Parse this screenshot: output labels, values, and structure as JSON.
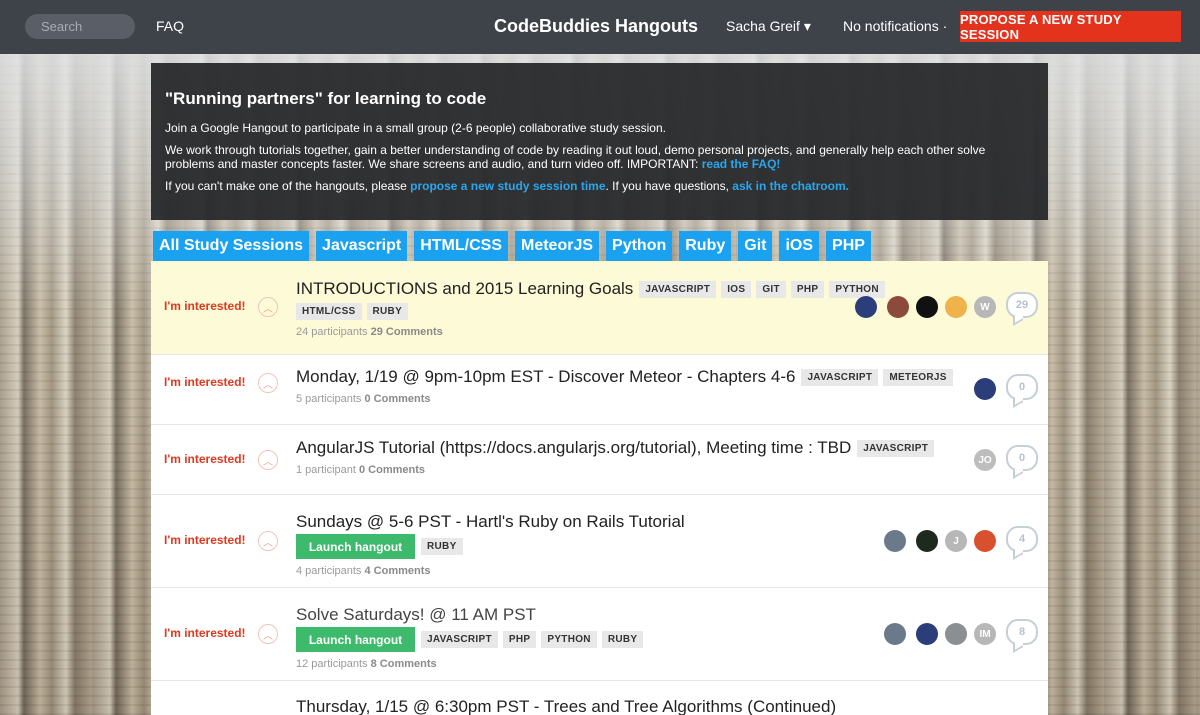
{
  "topbar": {
    "search_placeholder": "Search",
    "faq": "FAQ",
    "brand": "CodeBuddies Hangouts",
    "user": "Sacha Greif ▾",
    "notifications": "No notifications ·",
    "propose_button": "PROPOSE A NEW STUDY SESSION"
  },
  "intro": {
    "heading": "\"Running partners\" for learning to code",
    "p1": "Join a Google Hangout to participate in a small group (2-6 people) collaborative study session.",
    "p2_text": "We work through tutorials together, gain a better understanding of code by reading it out loud, demo personal projects, and generally help each other solve problems and master concepts faster. We share screens and audio, and turn video off. IMPORTANT: ",
    "p2_link": "read the FAQ!",
    "p3_a": "If you can't make one of the hangouts, please ",
    "p3_link1": "propose a new study session time",
    "p3_b": ". If you have questions, ",
    "p3_link2": "ask in the chatroom."
  },
  "tabs": [
    "All Study Sessions",
    "Javascript",
    "HTML/CSS",
    "MeteorJS",
    "Python",
    "Ruby",
    "Git",
    "iOS",
    "PHP"
  ],
  "sessions": [
    {
      "interested": "I'm interested!",
      "title": "INTRODUCTIONS and 2015 Learning Goals",
      "tags": [
        "JAVASCRIPT",
        "IOS",
        "GIT",
        "PHP",
        "PYTHON",
        "HTML/CSS",
        "RUBY"
      ],
      "participants": "24 participants",
      "comments": "29 Comments",
      "comment_count": "29",
      "avatars": [
        "",
        "",
        "",
        "",
        "W"
      ]
    },
    {
      "interested": "I'm interested!",
      "title": "Monday, 1/19 @ 9pm-10pm EST - Discover Meteor - Chapters 4-6",
      "tags": [
        "JAVASCRIPT",
        "METEORJS"
      ],
      "participants": "5 participants",
      "comments": "0 Comments",
      "comment_count": "0",
      "avatars": [
        ""
      ]
    },
    {
      "interested": "I'm interested!",
      "title": "AngularJS Tutorial (https://docs.angularjs.org/tutorial), Meeting time : TBD",
      "tags": [
        "JAVASCRIPT"
      ],
      "participants": "1 participant",
      "comments": "0 Comments",
      "comment_count": "0",
      "avatars": [
        "JO"
      ]
    },
    {
      "interested": "I'm interested!",
      "title": "Sundays @ 5-6 PST - Hartl's Ruby on Rails Tutorial",
      "launch": "Launch hangout",
      "tags": [
        "RUBY"
      ],
      "participants": "4 participants",
      "comments": "4 Comments",
      "comment_count": "4",
      "avatars": [
        "",
        "",
        "J",
        ""
      ]
    },
    {
      "interested": "I'm interested!",
      "title": "Solve Saturdays! @ 11 AM PST",
      "launch": "Launch hangout",
      "tags": [
        "JAVASCRIPT",
        "PHP",
        "PYTHON",
        "RUBY"
      ],
      "participants": "12 participants",
      "comments": "8 Comments",
      "comment_count": "8",
      "avatars": [
        "",
        "",
        "",
        "IM"
      ]
    },
    {
      "title": "Thursday, 1/15 @ 6:30pm PST - Trees and Tree Algorithms (Continued)"
    }
  ],
  "colors": {
    "accent_red": "#e4331d",
    "tab_blue": "#1aa1f0",
    "launch_green": "#3dba6c",
    "link_blue": "#2aa6ee"
  }
}
